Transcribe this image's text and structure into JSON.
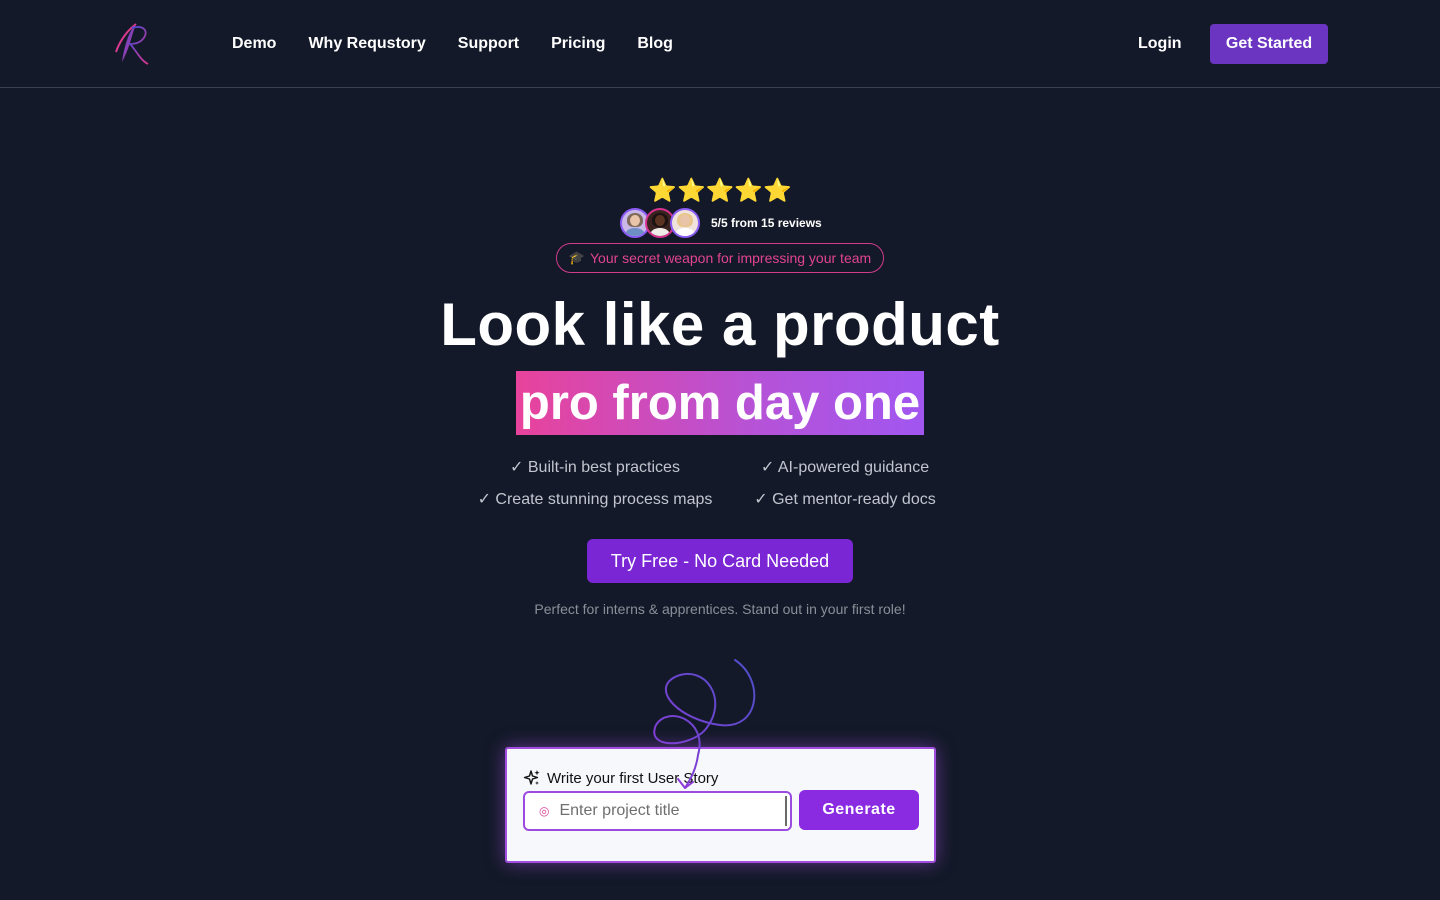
{
  "header": {
    "nav": [
      "Demo",
      "Why Requstory",
      "Support",
      "Pricing",
      "Blog"
    ],
    "login_label": "Login",
    "get_started_label": "Get Started"
  },
  "hero": {
    "stars": "⭐⭐⭐⭐⭐",
    "rating": 5,
    "reviews_text": "5/5 from 15 reviews",
    "pill_icon": "graduation-cap-icon",
    "pill_text": "Your secret weapon for impressing your team",
    "headline": "Look like a product",
    "headline_highlight": "pro from day one",
    "features": [
      "✓ Built-in best practices",
      "✓ AI-powered guidance",
      "✓ Create stunning process maps",
      "✓ Get mentor-ready docs"
    ],
    "cta_label": "Try Free - No Card Needed",
    "subtext": "Perfect for interns & apprentices. Stand out in your first role!"
  },
  "story_card": {
    "title": "Write your first User Story",
    "input_placeholder": "Enter project title",
    "input_value": "",
    "generate_label": "Generate"
  },
  "colors": {
    "background": "#131928",
    "accent_purple": "#7a26d4",
    "pink": "#e8439b"
  }
}
